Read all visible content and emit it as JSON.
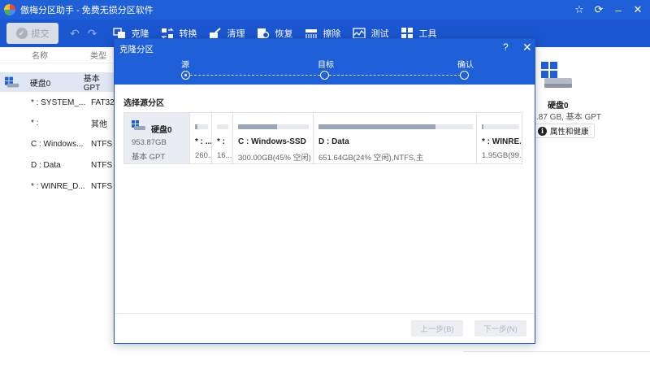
{
  "app": {
    "title": "傲梅分区助手 - 免费无损分区软件",
    "controls": {
      "star": "☆",
      "refresh": "⟳",
      "minimize": "–",
      "close": "✕"
    }
  },
  "toolbar": {
    "submit": "提交",
    "undo": "↶",
    "redo": "↷",
    "tools": [
      "克隆",
      "转换",
      "清理",
      "恢复",
      "擦除",
      "测试",
      "工具"
    ]
  },
  "left_panel": {
    "col_name": "名称",
    "col_type": "类型",
    "disk": {
      "name": "硬盘0",
      "type": "基本 GPT"
    },
    "partitions": [
      {
        "name": "* : SYSTEM_...",
        "type": "FAT32"
      },
      {
        "name": "* :",
        "type": "其他"
      },
      {
        "name": "C : Windows...",
        "type": "NTFS"
      },
      {
        "name": "D : Data",
        "type": "NTFS"
      },
      {
        "name": "* : WINRE_D...",
        "type": "NTFS"
      }
    ]
  },
  "right_panel": {
    "disk_name": "硬盘0",
    "disk_size": ".87 GB, 基本 GPT",
    "props_button": "属性和健康"
  },
  "dialog": {
    "title": "克隆分区",
    "help": "?",
    "close": "✕",
    "steps": [
      "源",
      "目标",
      "确认"
    ],
    "section_title": "选择源分区",
    "disk": {
      "name": "硬盘0",
      "size": "953.87GB",
      "kind": "基本 GPT"
    },
    "partitions": [
      {
        "name": "* : ...",
        "detail": "260...",
        "fill": 0.2
      },
      {
        "name": "* :",
        "detail": "16...",
        "fill": 0.0
      },
      {
        "name": "C : Windows-SSD",
        "detail": "300.00GB(45% 空闲),...",
        "fill": 0.55
      },
      {
        "name": "D : Data",
        "detail": "651.64GB(24% 空闲),NTFS,主",
        "fill": 0.76
      },
      {
        "name": "* : WINRE...",
        "detail": "1.95GB(99...",
        "fill": 0.05
      }
    ],
    "prev_button": "上一步(B)",
    "next_button": "下一步(N)"
  }
}
